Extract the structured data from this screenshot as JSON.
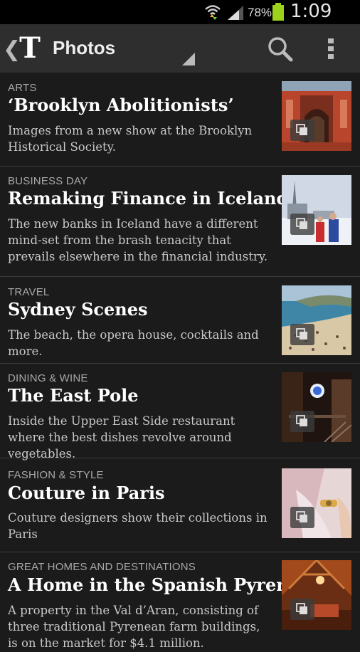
{
  "status_bar": {
    "battery_percent": "78%",
    "time": "1:09 PM",
    "icons": [
      "wifi-icon",
      "signal-icon",
      "battery-icon"
    ]
  },
  "action_bar": {
    "back_label": "❮",
    "logo_text": "T",
    "title": "Photos",
    "icons": [
      "search-icon",
      "overflow-menu-icon",
      "dropdown-indicator-icon"
    ]
  },
  "articles": [
    {
      "category": "ARTS",
      "title": "‘Brooklyn Abolitionists’",
      "description": "Images from a new show at the Brooklyn Historical Society."
    },
    {
      "category": "BUSINESS DAY",
      "title": "Remaking Finance in Iceland",
      "description": "The new banks in Iceland have a different mind-set from the brash tenacity that prevails elsewhere in the financial industry."
    },
    {
      "category": "TRAVEL",
      "title": "Sydney Scenes",
      "description": "The beach, the opera house, cocktails and more."
    },
    {
      "category": "DINING & WINE",
      "title": "The East Pole",
      "description": "Inside the Upper East Side restaurant where the best dishes revolve around vegetables."
    },
    {
      "category": "FASHION & STYLE",
      "title": "Couture in Paris",
      "description": "Couture designers show their collections in Paris"
    },
    {
      "category": "GREAT HOMES AND DESTINATIONS",
      "title": "A Home in the Spanish Pyrenees",
      "description": "A property in the Val d’Aran, consisting of three traditional Pyrenean farm buildings, is on the market for $4.1 million."
    }
  ]
}
